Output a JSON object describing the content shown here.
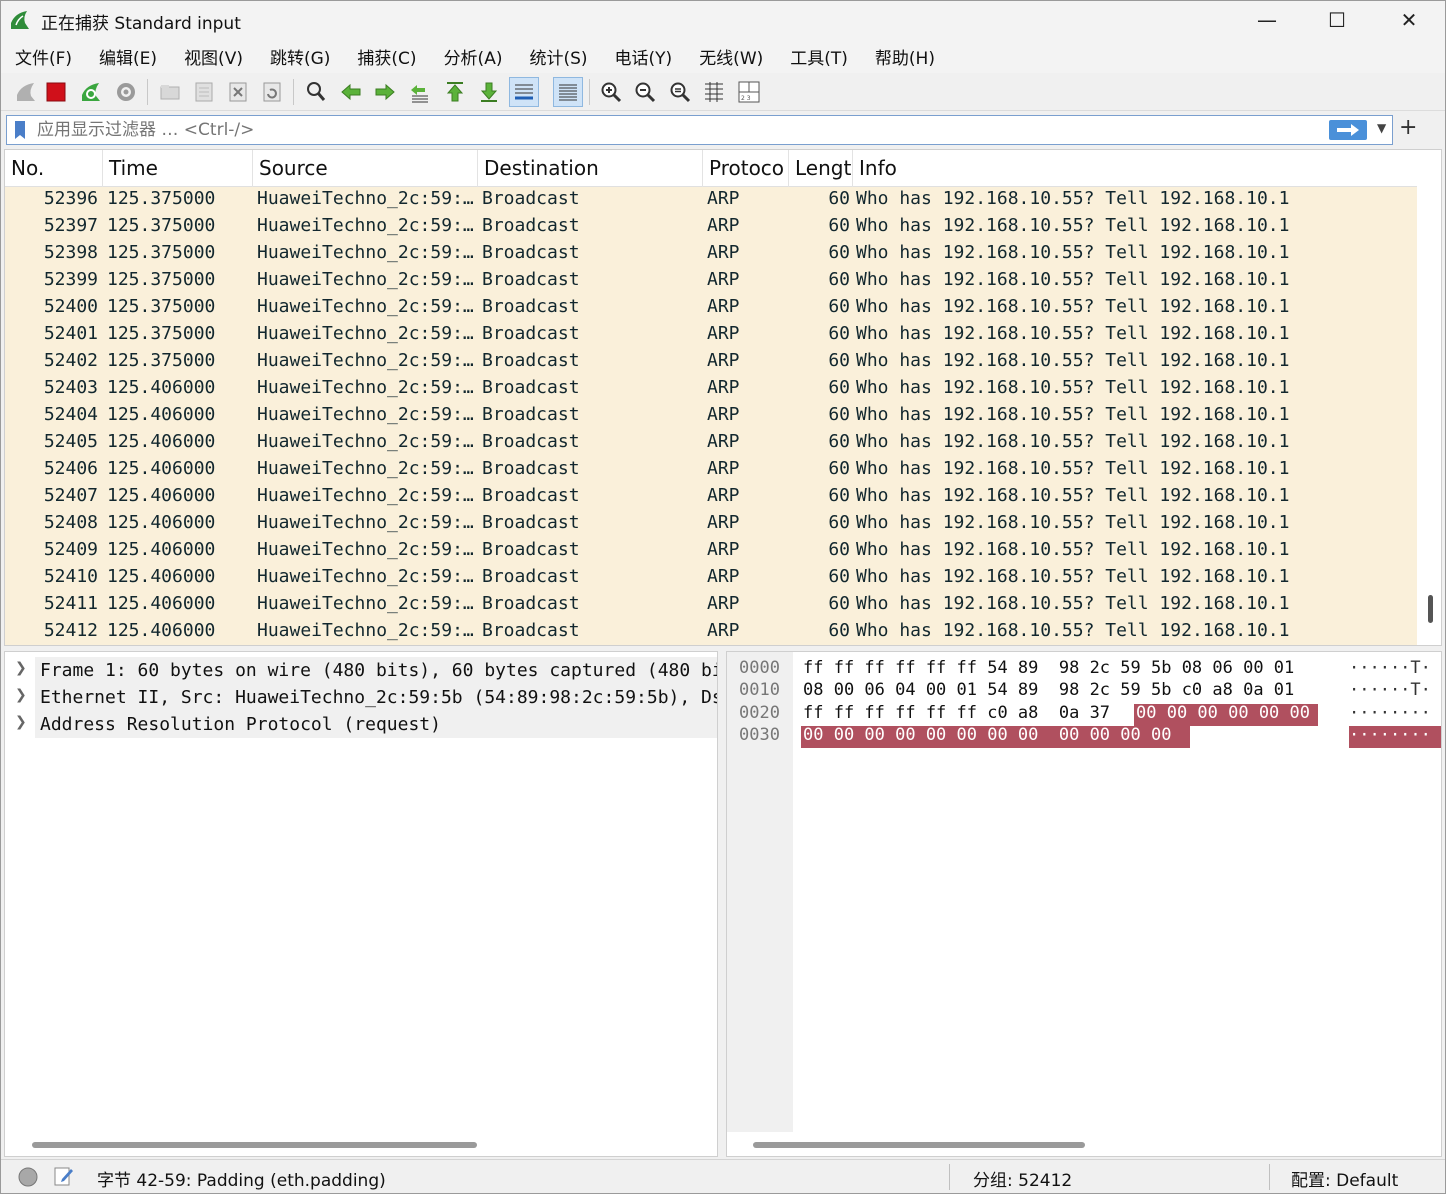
{
  "window": {
    "title": "正在捕获 Standard input",
    "minimize": "—",
    "maximize": "☐",
    "close": "✕"
  },
  "menu": [
    "文件(F)",
    "编辑(E)",
    "视图(V)",
    "跳转(G)",
    "捕获(C)",
    "分析(A)",
    "统计(S)",
    "电话(Y)",
    "无线(W)",
    "工具(T)",
    "帮助(H)"
  ],
  "filter": {
    "placeholder": "应用显示过滤器 … <Ctrl-/>",
    "add": "+"
  },
  "packet_list": {
    "columns": [
      "No.",
      "Time",
      "Source",
      "Destination",
      "Protoco",
      "Lengt",
      "Info"
    ],
    "rows": [
      [
        "52396",
        "125.375000",
        "HuaweiTechno_2c:59:…",
        "Broadcast",
        "ARP",
        "60",
        "Who has 192.168.10.55? Tell 192.168.10.1"
      ],
      [
        "52397",
        "125.375000",
        "HuaweiTechno_2c:59:…",
        "Broadcast",
        "ARP",
        "60",
        "Who has 192.168.10.55? Tell 192.168.10.1"
      ],
      [
        "52398",
        "125.375000",
        "HuaweiTechno_2c:59:…",
        "Broadcast",
        "ARP",
        "60",
        "Who has 192.168.10.55? Tell 192.168.10.1"
      ],
      [
        "52399",
        "125.375000",
        "HuaweiTechno_2c:59:…",
        "Broadcast",
        "ARP",
        "60",
        "Who has 192.168.10.55? Tell 192.168.10.1"
      ],
      [
        "52400",
        "125.375000",
        "HuaweiTechno_2c:59:…",
        "Broadcast",
        "ARP",
        "60",
        "Who has 192.168.10.55? Tell 192.168.10.1"
      ],
      [
        "52401",
        "125.375000",
        "HuaweiTechno_2c:59:…",
        "Broadcast",
        "ARP",
        "60",
        "Who has 192.168.10.55? Tell 192.168.10.1"
      ],
      [
        "52402",
        "125.375000",
        "HuaweiTechno_2c:59:…",
        "Broadcast",
        "ARP",
        "60",
        "Who has 192.168.10.55? Tell 192.168.10.1"
      ],
      [
        "52403",
        "125.406000",
        "HuaweiTechno_2c:59:…",
        "Broadcast",
        "ARP",
        "60",
        "Who has 192.168.10.55? Tell 192.168.10.1"
      ],
      [
        "52404",
        "125.406000",
        "HuaweiTechno_2c:59:…",
        "Broadcast",
        "ARP",
        "60",
        "Who has 192.168.10.55? Tell 192.168.10.1"
      ],
      [
        "52405",
        "125.406000",
        "HuaweiTechno_2c:59:…",
        "Broadcast",
        "ARP",
        "60",
        "Who has 192.168.10.55? Tell 192.168.10.1"
      ],
      [
        "52406",
        "125.406000",
        "HuaweiTechno_2c:59:…",
        "Broadcast",
        "ARP",
        "60",
        "Who has 192.168.10.55? Tell 192.168.10.1"
      ],
      [
        "52407",
        "125.406000",
        "HuaweiTechno_2c:59:…",
        "Broadcast",
        "ARP",
        "60",
        "Who has 192.168.10.55? Tell 192.168.10.1"
      ],
      [
        "52408",
        "125.406000",
        "HuaweiTechno_2c:59:…",
        "Broadcast",
        "ARP",
        "60",
        "Who has 192.168.10.55? Tell 192.168.10.1"
      ],
      [
        "52409",
        "125.406000",
        "HuaweiTechno_2c:59:…",
        "Broadcast",
        "ARP",
        "60",
        "Who has 192.168.10.55? Tell 192.168.10.1"
      ],
      [
        "52410",
        "125.406000",
        "HuaweiTechno_2c:59:…",
        "Broadcast",
        "ARP",
        "60",
        "Who has 192.168.10.55? Tell 192.168.10.1"
      ],
      [
        "52411",
        "125.406000",
        "HuaweiTechno_2c:59:…",
        "Broadcast",
        "ARP",
        "60",
        "Who has 192.168.10.55? Tell 192.168.10.1"
      ],
      [
        "52412",
        "125.406000",
        "HuaweiTechno_2c:59:…",
        "Broadcast",
        "ARP",
        "60",
        "Who has 192.168.10.55? Tell 192.168.10.1"
      ]
    ],
    "row_bg": "#faf0da"
  },
  "details": [
    "Frame 1: 60 bytes on wire (480 bits), 60 bytes captured (480 bi",
    "Ethernet II, Src: HuaweiTechno_2c:59:5b (54:89:98:2c:59:5b), Ds",
    "Address Resolution Protocol (request)"
  ],
  "bytes": {
    "offsets": [
      "0000",
      "0010",
      "0020",
      "0030"
    ],
    "hex_lines": [
      "ff ff ff ff ff ff 54 89  98 2c 59 5b 08 06 00 01",
      "08 00 06 04 00 01 54 89  98 2c 59 5b c0 a8 0a 01",
      "ff ff ff ff ff ff c0 a8  0a 37",
      ""
    ],
    "hex_hl_2": "00 00 00 00 00 00",
    "hex_hl_3": "00 00 00 00 00 00 00 00  00 00 00 00",
    "ascii_lines": [
      "······T·",
      "······T·",
      "········",
      "········"
    ],
    "highlight_color": "#b0505f"
  },
  "status": {
    "field": "字节 42-59: Padding (eth.padding)",
    "packets": "分组: 52412",
    "profile": "配置: Default"
  }
}
